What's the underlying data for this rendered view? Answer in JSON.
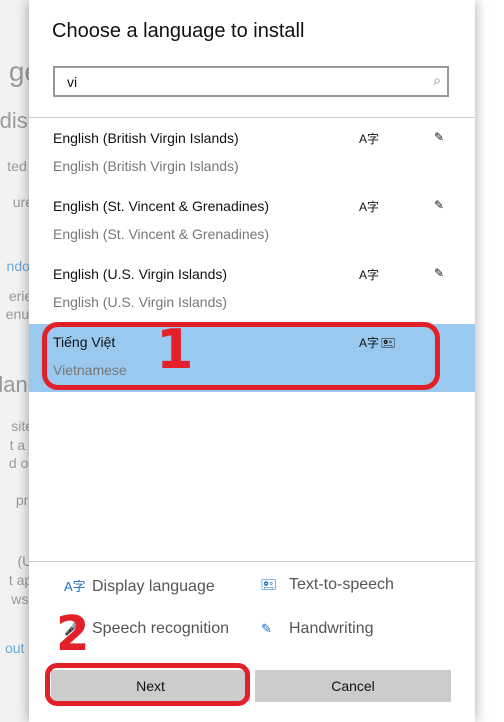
{
  "background": {
    "fragments": [
      {
        "text": "ge"
      },
      {
        "text": "disp"
      },
      {
        "text": "ted S"
      },
      {
        "text": "ures"
      },
      {
        "text": "ndow",
        "link": true
      },
      {
        "text": "erien"
      },
      {
        "text": "enus,"
      },
      {
        "text": "lang"
      },
      {
        "text": "sites"
      },
      {
        "text": "t a la"
      },
      {
        "text": "d oth"
      },
      {
        "text": "pref"
      },
      {
        "text": "(Un"
      },
      {
        "text": "t app"
      },
      {
        "text": "ws d"
      },
      {
        "text": "out m",
        "link": true
      }
    ]
  },
  "dialog": {
    "title": "Choose a language to install",
    "search": {
      "value": "vi",
      "icon": "search-icon"
    },
    "languages": [
      {
        "name": "English (British Virgin Islands)",
        "english": "English (British Virgin Islands)",
        "icons": [
          "display-language-icon",
          "handwriting-icon"
        ],
        "selected": false
      },
      {
        "name": "English (St. Vincent & Grenadines)",
        "english": "English (St. Vincent & Grenadines)",
        "icons": [
          "display-language-icon",
          "handwriting-icon"
        ],
        "selected": false
      },
      {
        "name": "English (U.S. Virgin Islands)",
        "english": "English (U.S. Virgin Islands)",
        "icons": [
          "display-language-icon",
          "handwriting-icon"
        ],
        "selected": false
      },
      {
        "name": "Tiếng Việt",
        "english": "Vietnamese",
        "icons": [
          "display-language-icon",
          "text-to-speech-icon"
        ],
        "selected": true
      }
    ],
    "legend": {
      "display": "Display language",
      "tts": "Text-to-speech",
      "speech": "Speech recognition",
      "handwriting": "Handwriting"
    },
    "next_label": "Next",
    "cancel_label": "Cancel"
  },
  "annotations": {
    "step1": "1",
    "step2": "2",
    "color": "#e3202a"
  },
  "colors": {
    "selected": "#99c9ef",
    "accent": "#1a6fc4"
  }
}
